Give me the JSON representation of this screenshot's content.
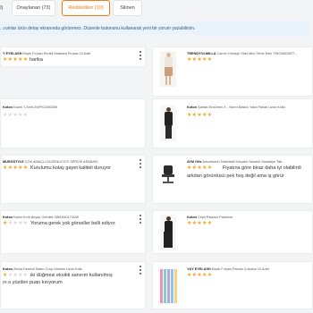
{
  "tabs": [
    {
      "label": "(0)",
      "active": false
    },
    {
      "label": "Onaylanan (73)",
      "active": false
    },
    {
      "label": "Reddedilen (10)",
      "active": true
    },
    {
      "label": "Silinen",
      "active": false
    }
  ],
  "banner": "...rumlar ürün detay ekranında görünmez. Düzenle butonunu kullanarak yeni bir yorum yazabilirsin.",
  "cards_left": [
    {
      "brand": "Y EYELASH",
      "product": "Kirpik Fırçası Renkli Maskara Fırçası 10 Adet",
      "rating": 5,
      "comment": [
        "harika"
      ]
    },
    {
      "brand": "Koton",
      "product": "Kadın T-Shirt 2WFK10002BK",
      "rating": 0,
      "comment": []
    },
    {
      "brand": "MURGSTYLE",
      "product": "ÇOK AMAÇLI DÜZENLEYİCİ SERVİS ARABASI",
      "rating": 5,
      "comment": [
        "Kurulumu kolay gayet kaliteli duruyor"
      ]
    },
    {
      "brand": "Koton",
      "product": "Kadın Kırık Beyaz Gömlek 3WAK60173UW",
      "rating": 1,
      "comment": [
        "Yoruma gerek yok görseller belli ediyor."
      ]
    },
    {
      "brand": "Koton",
      "product": "Zebra Desenli Saten Crop Gömlek Uzun Kollu",
      "rating": 1,
      "comment": [
        "iki düğmesi eksikti sanırım kullanılmış",
        "ın o yüzden puan kırıyorum"
      ]
    }
  ],
  "cards_right": [
    {
      "brand": "TRENDYOLMILLA",
      "product": "Camel Yıtmaçlı Süet Mini Örme Etek TWOAW20ET...",
      "rating": 5,
      "comment": []
    },
    {
      "brand": "Koton",
      "product": "Şahika Ercümen X - Yarım Baskılı Yaka Parlak Uzun Kollu",
      "rating": 5,
      "comment": []
    },
    {
      "brand": "AYM Ofis",
      "product": "Amortisörlü Tekerlekli Kolçaklı Yazarlık Sandalye Tab...",
      "rating": 5,
      "comment": [
        "Fiyatına göre biraz daha iyi olabilirdi",
        "arkdan görüntüsü pek hoş değil ama iş görür"
      ]
    },
    {
      "brand": "Koton",
      "product": "Cepli Palazzo Pantolon",
      "rating": 5,
      "comment": []
    },
    {
      "brand": "Y&Y EYELASH",
      "product": "Kirpik Fırçası Pamuk Çubuklu 10 Adet",
      "rating": 5,
      "comment": []
    }
  ],
  "icons": {
    "more": "more-vertical-icon",
    "star": "star-icon"
  },
  "colors": {
    "accent": "#f27a1a",
    "star": "#f5a623",
    "star_off": "#d8d8d8",
    "banner_bg": "#e8f3fc"
  }
}
